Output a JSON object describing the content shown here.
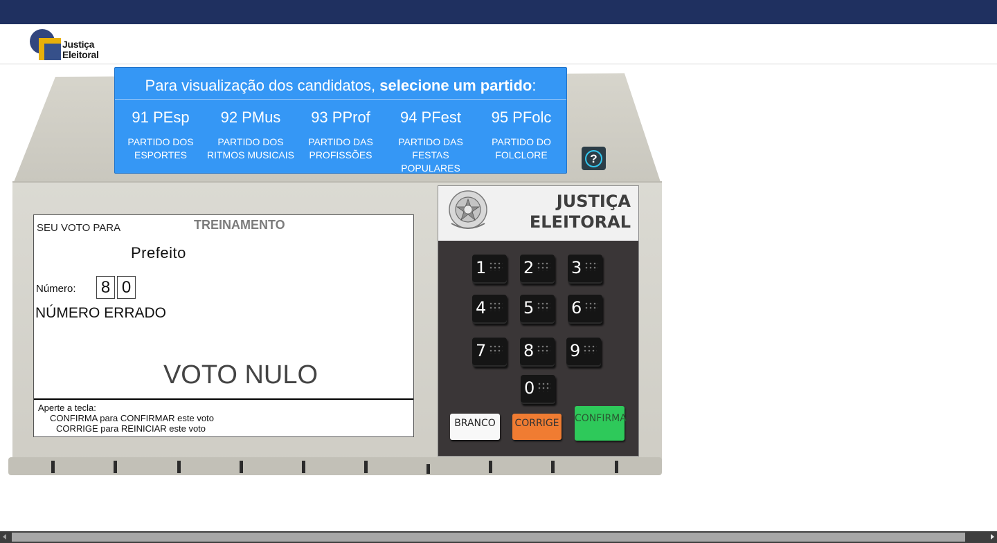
{
  "header": {
    "logo_line1": "Justiça",
    "logo_line2": "Eleitoral"
  },
  "party_panel": {
    "title_prefix": "Para visualização dos candidatos, ",
    "title_bold": "selecione um partido",
    "title_suffix": ":",
    "parties": [
      {
        "code": "91 PEsp",
        "name_l1": "PARTIDO DOS",
        "name_l2": "ESPORTES"
      },
      {
        "code": "92 PMus",
        "name_l1": "PARTIDO DOS",
        "name_l2": "RITMOS MUSICAIS"
      },
      {
        "code": "93 PProf",
        "name_l1": "PARTIDO DAS",
        "name_l2": "PROFISSÕES"
      },
      {
        "code": "94 PFest",
        "name_l1": "PARTIDO DAS",
        "name_l2": "FESTAS POPULARES"
      },
      {
        "code": "95 PFolc",
        "name_l1": "PARTIDO DO",
        "name_l2": "FOLCLORE"
      }
    ],
    "help_symbol": "?"
  },
  "screen": {
    "vote_for": "SEU VOTO PARA",
    "mode": "TREINAMENTO",
    "office": "Prefeito",
    "number_label": "Número:",
    "digits": [
      "8",
      "0"
    ],
    "error": "NÚMERO ERRADO",
    "result": "VOTO NULO",
    "footer_l1": "Aperte a tecla:",
    "footer_l2": "CONFIRMA para CONFIRMAR este voto",
    "footer_l3": "CORRIGE para REINICIAR este voto"
  },
  "keypad": {
    "title_l1": "JUSTIÇA",
    "title_l2": "ELEITORAL",
    "keys": [
      "1",
      "2",
      "3",
      "4",
      "5",
      "6",
      "7",
      "8",
      "9",
      "0"
    ],
    "branco": "BRANCO",
    "corrige": "CORRIGE",
    "confirma": "CONFIRMA"
  },
  "colors": {
    "topbar": "#1f3060",
    "party_panel": "#3597f5",
    "urna_body": "#d9d8cf",
    "key_branco": "#f8f8f8",
    "key_corrige": "#f07c32",
    "key_confirma": "#2ec95a"
  },
  "icons": {
    "help": "question-circle-icon",
    "emblem": "coat-of-arms-icon"
  }
}
